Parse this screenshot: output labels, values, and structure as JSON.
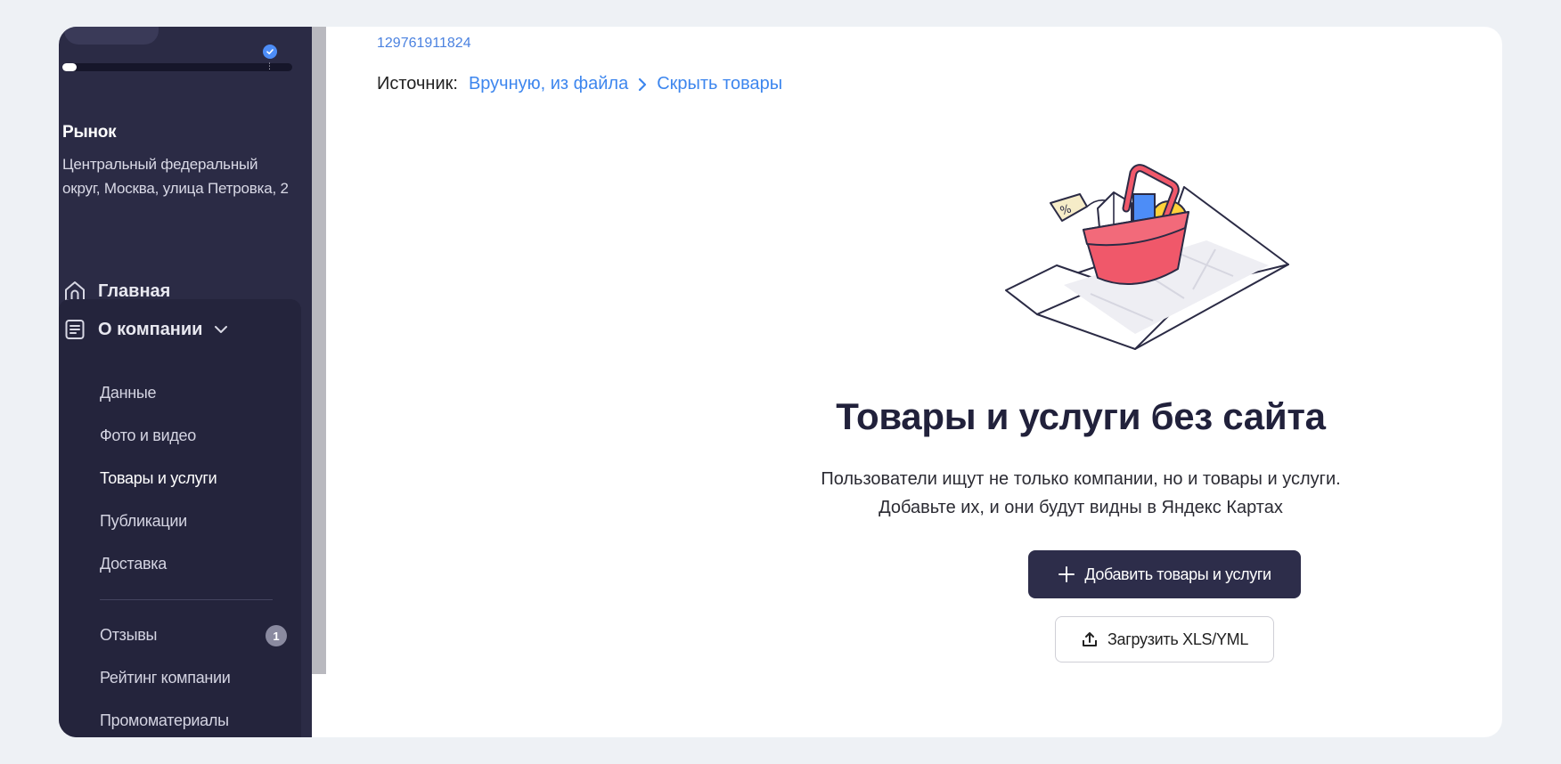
{
  "sidebar": {
    "org_name": "Рынок",
    "org_address": "Центральный федеральный округ, Москва, улица Петровка, 2",
    "nav_home": "Главная",
    "company_section": "О компании",
    "sub_items": [
      "Данные",
      "Фото и видео",
      "Товары и услуги",
      "Публикации",
      "Доставка",
      "Отзывы",
      "Рейтинг компании",
      "Промоматериалы"
    ],
    "reviews_count": "1",
    "active_item": "Товары и услуги",
    "accent_color": "#4d8df7"
  },
  "main": {
    "company_id": "129761911824",
    "source_label": "Источник:",
    "source_link": "Вручную, из файла",
    "hide_link": "Скрыть товары",
    "empty_title": "Товары и услуги без сайта",
    "empty_text_line1": "Пользователи ищут не только компании, но и товары и услуги.",
    "empty_text_line2": "Добавьте их, и они будут видны в Яндекс Картах",
    "add_button": "Добавить товары и услуги",
    "upload_button": "Загрузить XLS/YML",
    "tag_text": "%",
    "primary_color": "#2d2d4a",
    "link_color": "#3d86ee"
  }
}
